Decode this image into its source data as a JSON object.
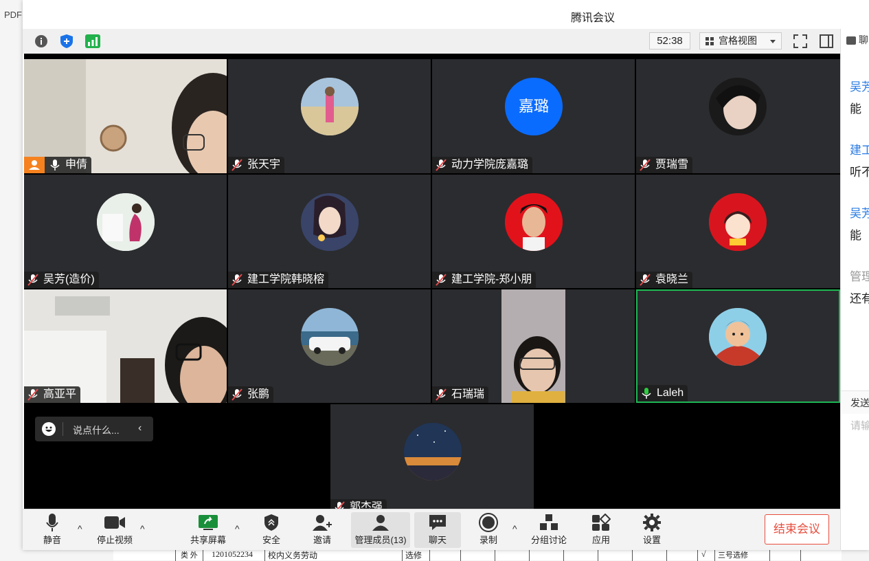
{
  "background": {
    "pdf_label": "PDF",
    "table_row": {
      "col1": "类\n外",
      "code": "1201052234",
      "course": "校内义务劳动",
      "type": "选修",
      "check": "√",
      "note": "三号选修"
    }
  },
  "window": {
    "title": "腾讯会议"
  },
  "infobar": {
    "timer": "52:38",
    "view_mode": "宫格视图",
    "chat_tab": "聊"
  },
  "participants": [
    {
      "name": "申倩",
      "muted": false,
      "host": true,
      "type": "video"
    },
    {
      "name": "张天宇",
      "muted": true,
      "type": "avatar"
    },
    {
      "name": "动力学院庞嘉璐",
      "muted": true,
      "type": "initials",
      "initials": "嘉璐"
    },
    {
      "name": "贾瑞雪",
      "muted": true,
      "type": "avatar"
    },
    {
      "name": "吴芳(造价)",
      "muted": true,
      "type": "avatar"
    },
    {
      "name": "建工学院韩晓榕",
      "muted": true,
      "type": "avatar"
    },
    {
      "name": "建工学院-郑小朋",
      "muted": true,
      "type": "avatar"
    },
    {
      "name": "袁晓兰",
      "muted": true,
      "type": "avatar"
    },
    {
      "name": "高亚平",
      "muted": true,
      "type": "video"
    },
    {
      "name": "张鹏",
      "muted": true,
      "type": "avatar"
    },
    {
      "name": "石瑞瑞",
      "muted": true,
      "type": "video"
    },
    {
      "name": "Laleh",
      "muted": false,
      "speaking": true,
      "type": "avatar"
    },
    {
      "name": "郭杰强",
      "muted": true,
      "type": "avatar"
    }
  ],
  "chat_input": {
    "placeholder": "说点什么..."
  },
  "toolbar": {
    "mute": "静音",
    "stop_video": "停止视频",
    "share": "共享屏幕",
    "security": "安全",
    "invite": "邀请",
    "manage": "管理成员(13)",
    "chat": "聊天",
    "record": "录制",
    "breakout": "分组讨论",
    "apps": "应用",
    "settings": "设置",
    "end": "结束会议"
  },
  "chat_panel": {
    "messages": [
      {
        "sender": "吴芳",
        "text": "能"
      },
      {
        "sender": "建工",
        "text": "听不"
      },
      {
        "sender": "吴芳",
        "text": "能"
      },
      {
        "sender": "管理",
        "text": "还有"
      }
    ],
    "send_label": "发送",
    "input_placeholder": "请输"
  },
  "colors": {
    "accent_blue": "#2a7be4",
    "active_green": "#1db954",
    "end_red": "#e74c3c",
    "initials_bg": "#0a6cff"
  }
}
